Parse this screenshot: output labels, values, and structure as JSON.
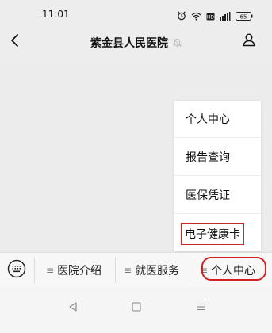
{
  "status_bar": {
    "time": "11:01",
    "icons": [
      "alarm-icon",
      "wifi-icon",
      "hd-icon",
      "signal-icon",
      "battery-icon"
    ],
    "battery_level": "65"
  },
  "header": {
    "title": "紫金县人民医院",
    "back_icon": "chevron-left-icon",
    "mute_icon": "bell-off-icon",
    "profile_icon": "person-icon"
  },
  "submenu": {
    "items": [
      {
        "label": "个人中心"
      },
      {
        "label": "报告查询"
      },
      {
        "label": "医保凭证"
      },
      {
        "label": "电子健康卡"
      }
    ],
    "highlighted_item": "电子健康卡",
    "highlight_color": "#c62828"
  },
  "menu_bar": {
    "keyboard_icon": "keyboard-icon",
    "items": [
      {
        "label": "医院介绍"
      },
      {
        "label": "就医服务"
      },
      {
        "label": "个人中心"
      }
    ],
    "highlight_color": "#d32020"
  },
  "system_nav": {
    "icons": [
      "back-triangle-icon",
      "home-square-icon",
      "menu-lines-icon"
    ]
  }
}
